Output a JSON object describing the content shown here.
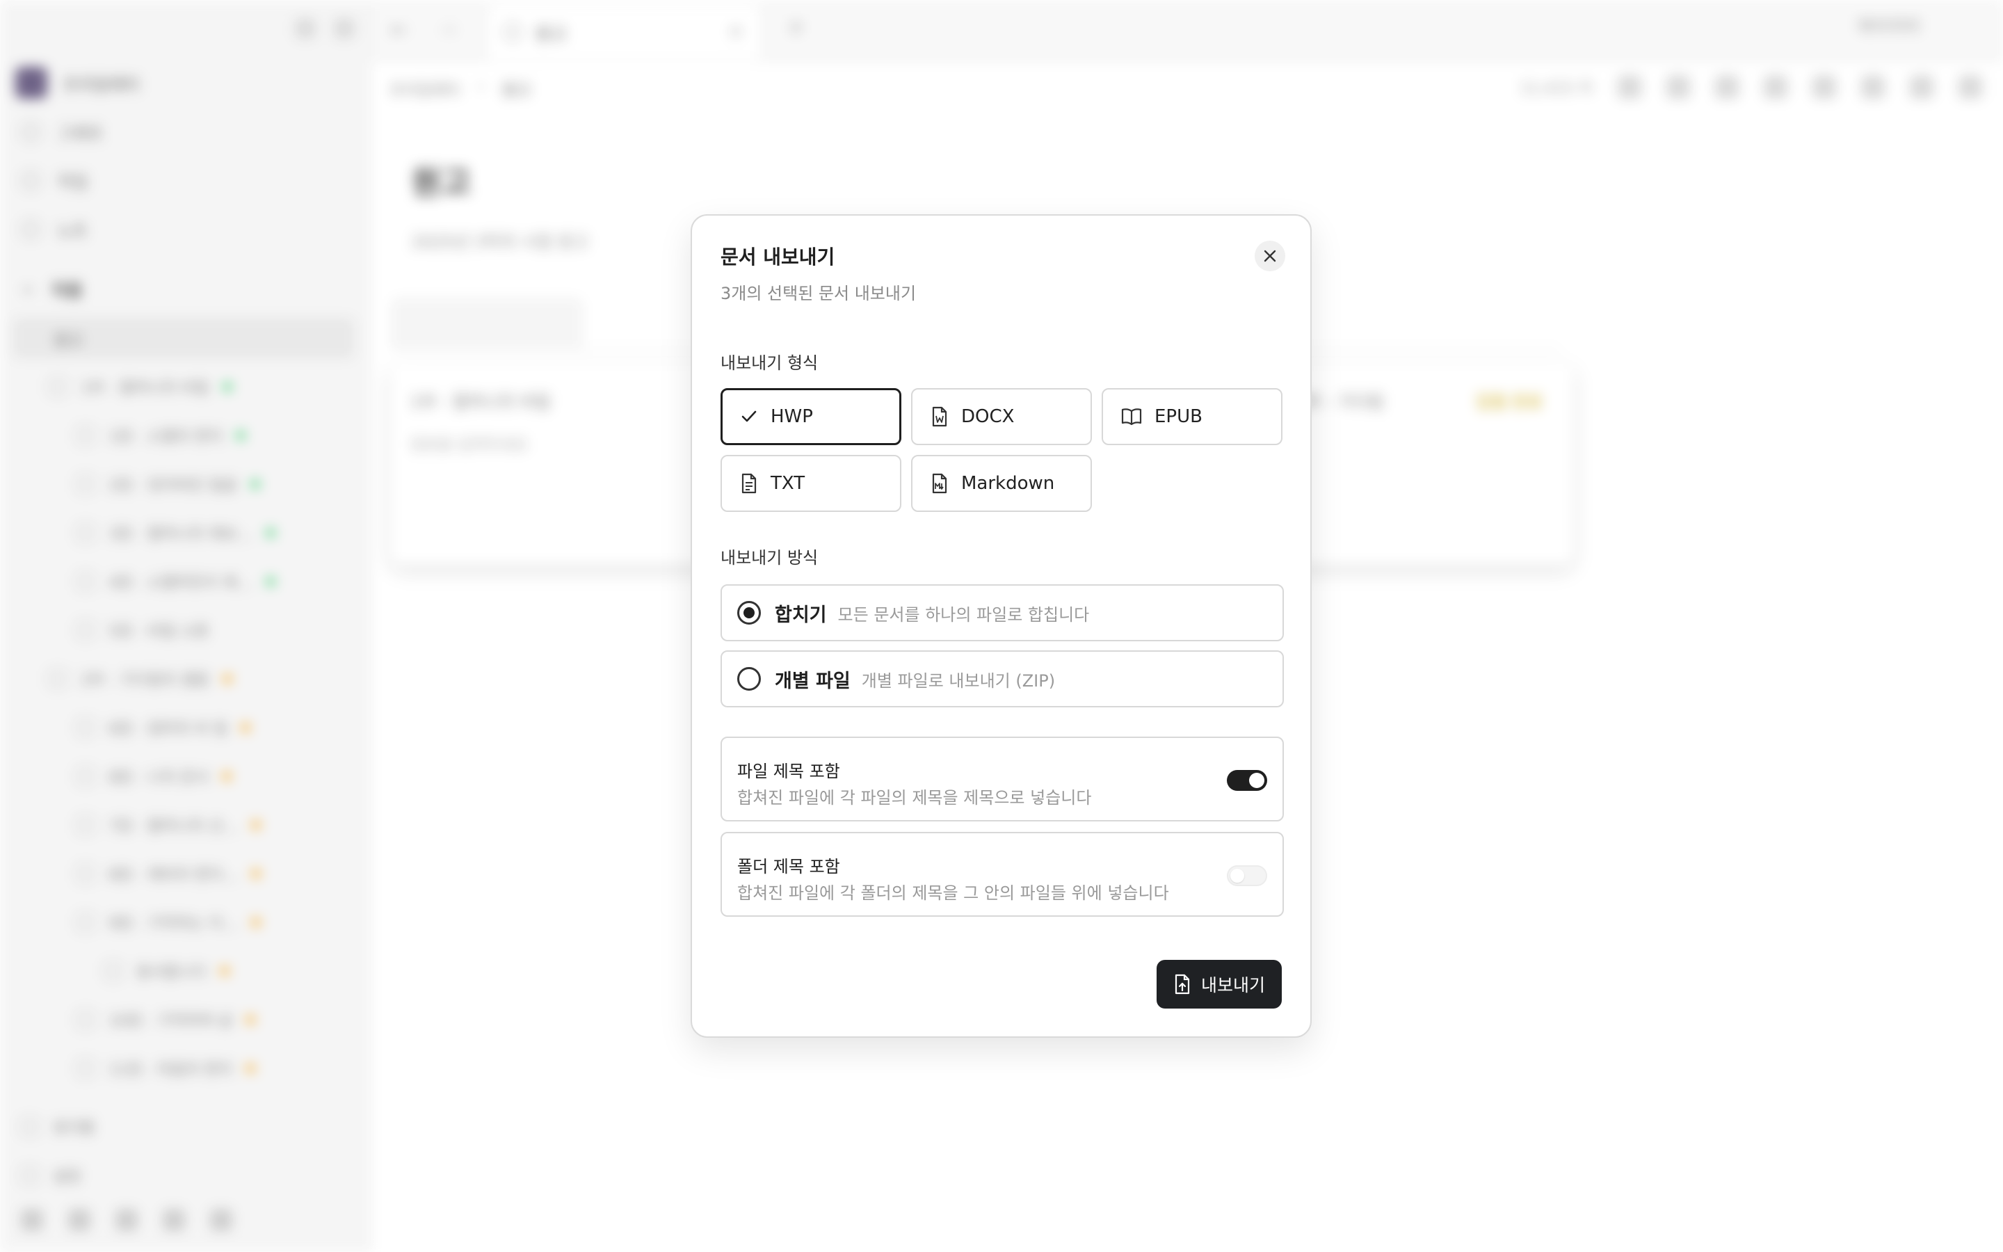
{
  "background": {
    "workspace_name": "프리덤레터",
    "sidebar_items": [
      "그래프",
      "작업",
      "노트"
    ],
    "section_title": "작품",
    "active_item": "원고",
    "tree": [
      {
        "label": "1부 - 할머니의 비밀",
        "dot": "#22c55e",
        "indent": 1
      },
      {
        "label": "1장 - 소멸의 편지",
        "dot": "#22c55e",
        "indent": 2
      },
      {
        "label": "2장 - 잊어버린 얼굴",
        "dot": "#22c55e",
        "indent": 2
      },
      {
        "label": "3장 - 할머니의 제보…",
        "dot": "#22c55e",
        "indent": 2
      },
      {
        "label": "4장 - 소멸하듯이 제…",
        "dot": "#22c55e",
        "indent": 2
      },
      {
        "label": "5장 - 비밀 소환",
        "dot": "",
        "indent": 2
      },
      {
        "label": "2부 - 기다림의 결말",
        "dot": "#f59e0b",
        "indent": 1
      },
      {
        "label": "6장 - 엄마의 비 밀",
        "dot": "#f59e0b",
        "indent": 2
      },
      {
        "label": "8장 - 나의 문서",
        "dot": "#f59e0b",
        "indent": 2
      },
      {
        "label": "7장 - 할머니의 선…",
        "dot": "#f59e0b",
        "indent": 2
      },
      {
        "label": "8장 - 제비의 편지…",
        "dot": "#f59e0b",
        "indent": 2
      },
      {
        "label": "9장 - 기억하는 이…",
        "dot": "#f59e0b",
        "indent": 2
      },
      {
        "label": "용서합니다",
        "dot": "#f59e0b",
        "indent": 3
      },
      {
        "label": "10장 - 기억하며 살",
        "dot": "#f59e0b",
        "indent": 2
      },
      {
        "label": "11장 - 마음의 편지",
        "dot": "#f59e0b",
        "indent": 2
      }
    ],
    "sidebar_bottom": [
      "휴지통",
      "설정"
    ],
    "tab_title": "원고",
    "breadcrumb": [
      "프리덤레터",
      "원고"
    ],
    "word_count": "11,415 자",
    "page_title": "원고",
    "page_subtitle": "2025년 3막의 시점 원고",
    "card_title": "1부 - 할머니의 비밀",
    "card_desc": "원본을 입력하세요",
    "card_right": "2부 - 기다림",
    "card_status": "집필 완료",
    "user": "파이지어"
  },
  "modal": {
    "title": "문서 내보내기",
    "subtitle": "3개의 선택된 문서 내보내기",
    "close_icon": "close-icon",
    "format_label": "내보내기 형식",
    "formats": [
      {
        "label": "HWP",
        "icon": "check-icon",
        "selected": true
      },
      {
        "label": "DOCX",
        "icon": "word-file-icon",
        "selected": false
      },
      {
        "label": "EPUB",
        "icon": "book-icon",
        "selected": false
      },
      {
        "label": "TXT",
        "icon": "text-file-icon",
        "selected": false
      },
      {
        "label": "Markdown",
        "icon": "markdown-file-icon",
        "selected": false
      }
    ],
    "method_label": "내보내기 방식",
    "methods": [
      {
        "name": "합치기",
        "desc": "모든 문서를 하나의 파일로 합칩니다",
        "selected": true
      },
      {
        "name": "개별 파일",
        "desc": "개별 파일로 내보내기 (ZIP)",
        "selected": false
      }
    ],
    "options": [
      {
        "name": "파일 제목 포함",
        "desc": "합쳐진 파일에 각 파일의 제목을 제목으로 넣습니다",
        "enabled": true
      },
      {
        "name": "폴더 제목 포함",
        "desc": "합쳐진 파일에 각 폴더의 제목을 그 안의 파일들 위에 넣습니다",
        "enabled": false
      }
    ],
    "export_button": "내보내기",
    "export_icon": "file-export-icon"
  }
}
